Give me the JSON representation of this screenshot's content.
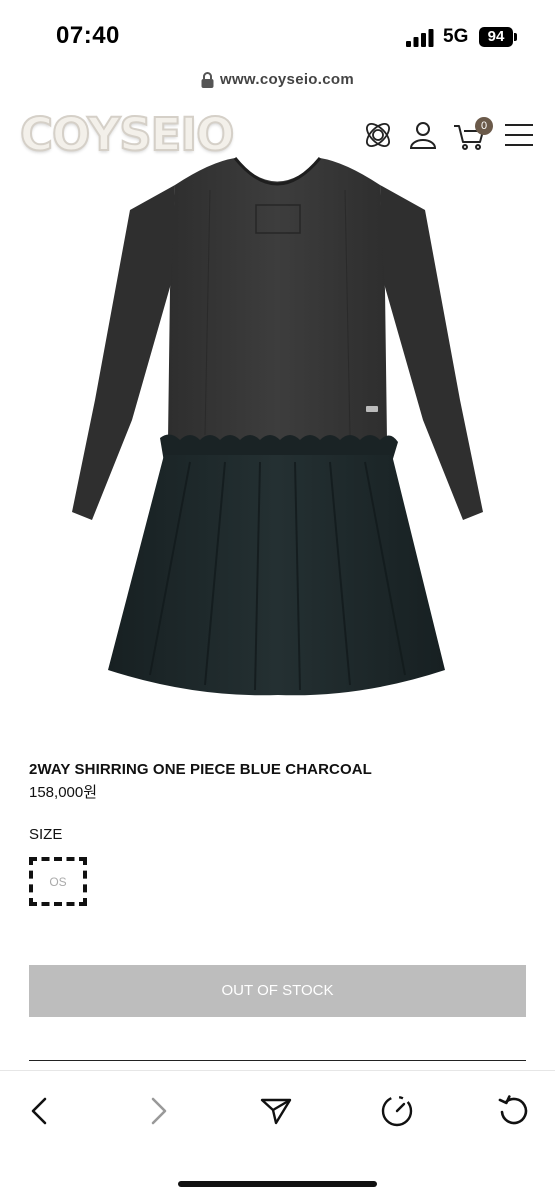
{
  "status_bar": {
    "time": "07:40",
    "network": "5G",
    "battery": "94"
  },
  "browser": {
    "url": "www.coyseio.com"
  },
  "header": {
    "logo": "COYSEIO",
    "cart_count": "0"
  },
  "product": {
    "name": "2WAY SHIRRING ONE PIECE BLUE CHARCOAL",
    "price": "158,000원",
    "size_label": "SIZE",
    "sizes": [
      "OS"
    ],
    "stock_status": "OUT OF STOCK"
  },
  "icons": {
    "header": [
      "brand-emblem-icon",
      "user-icon",
      "cart-icon",
      "menu-icon"
    ],
    "toolbar": [
      "back-icon",
      "forward-icon",
      "share-icon",
      "speed-dial-icon",
      "reload-icon"
    ]
  },
  "colors": {
    "button_disabled": "#bdbdbd",
    "cart_badge": "#6b5a4a",
    "dress_top": "#3a3a3a",
    "dress_skirt": "#1f2a2c"
  }
}
